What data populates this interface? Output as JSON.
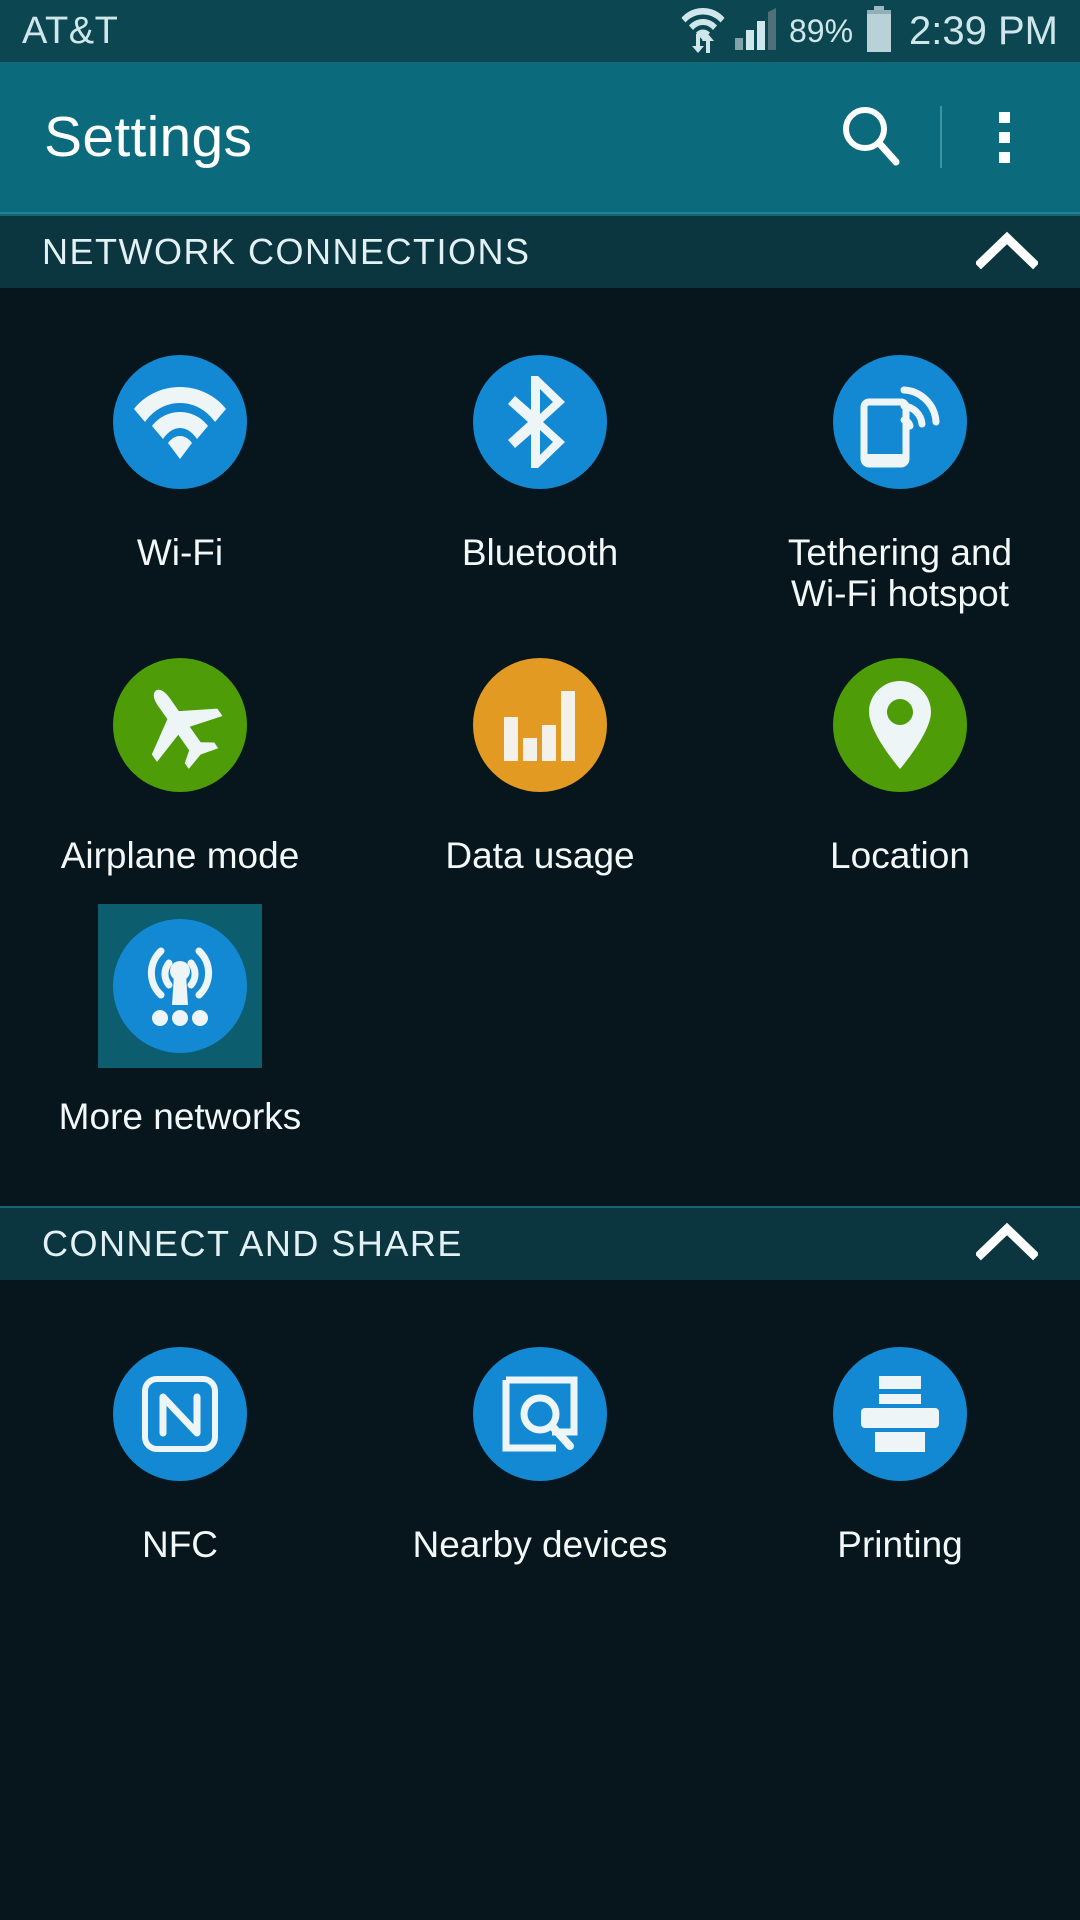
{
  "status_bar": {
    "carrier": "AT&T",
    "battery_percent": "89%",
    "clock": "2:39 PM",
    "wifi_icon": "wifi-transfer-icon",
    "signal_icon": "cellular-signal-icon",
    "battery_icon": "battery-icon",
    "signal_bars_filled": 3,
    "signal_bars_total": 4,
    "background_color": "#0c4650",
    "text_color": "#cfe6ea"
  },
  "action_bar": {
    "title": "Settings",
    "search_label": "Search",
    "overflow_label": "More options",
    "background_color": "#0b6b7d"
  },
  "sections": [
    {
      "title": "NETWORK CONNECTIONS",
      "collapse_state": "expanded",
      "chevron_icon": "chevron-up-icon",
      "items": [
        {
          "label": "Wi-Fi",
          "icon": "wifi-icon",
          "color": "#1389d4",
          "selected": false
        },
        {
          "label": "Bluetooth",
          "icon": "bluetooth-icon",
          "color": "#1389d4",
          "selected": false
        },
        {
          "label": "Tethering and\nWi-Fi hotspot",
          "icon": "tethering-hotspot-icon",
          "color": "#1389d4",
          "selected": false
        },
        {
          "label": "Airplane mode",
          "icon": "airplane-icon",
          "color": "#4e9c07",
          "selected": false
        },
        {
          "label": "Data usage",
          "icon": "data-usage-icon",
          "color": "#e29a22",
          "selected": false
        },
        {
          "label": "Location",
          "icon": "location-pin-icon",
          "color": "#4e9c07",
          "selected": false
        },
        {
          "label": "More networks",
          "icon": "broadcast-antenna-icon",
          "color": "#1389d4",
          "selected": true
        }
      ]
    },
    {
      "title": "CONNECT AND SHARE",
      "collapse_state": "expanded",
      "chevron_icon": "chevron-up-icon",
      "items": [
        {
          "label": "NFC",
          "icon": "nfc-icon",
          "color": "#1389d4",
          "selected": false
        },
        {
          "label": "Nearby devices",
          "icon": "nearby-devices-icon",
          "color": "#1389d4",
          "selected": false
        },
        {
          "label": "Printing",
          "icon": "printer-icon",
          "color": "#1389d4",
          "selected": false
        }
      ]
    }
  ],
  "theme": {
    "page_background": "#06161c",
    "section_header_background": "#0b3640",
    "selection_highlight": "#0c5d6d",
    "label_color": "#f2f7f8"
  }
}
